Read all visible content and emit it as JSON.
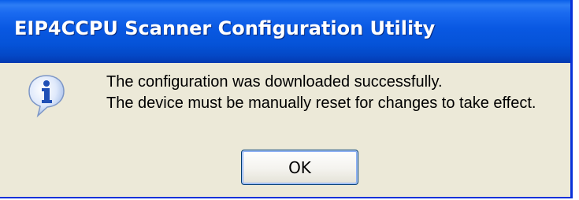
{
  "window": {
    "title": "EIP4CCPU Scanner Configuration Utility"
  },
  "dialog": {
    "icon": "information-icon",
    "message_line1": "The configuration was downloaded successfully.",
    "message_line2": "The device must be manually reset for changes to take effect.",
    "ok_label": "OK"
  },
  "colors": {
    "titlebar": "#0553d8",
    "dialog_background": "#ece9d8",
    "button_border": "#003c74"
  }
}
